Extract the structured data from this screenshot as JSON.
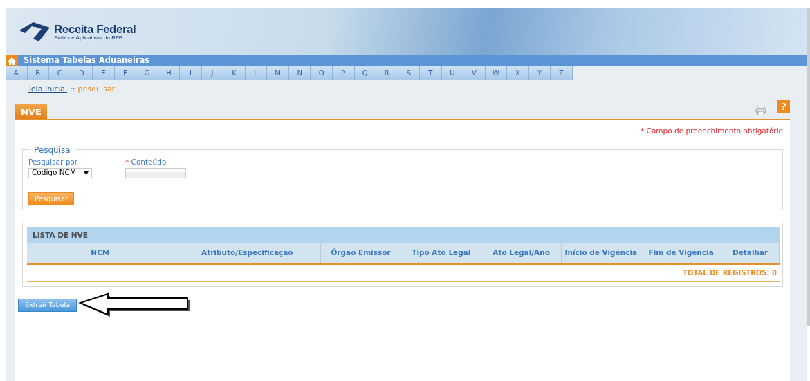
{
  "header": {
    "logo_title": "Receita Federal",
    "logo_subtitle": "Suíte de Aplicativos da RFB"
  },
  "system_title": "Sistema Tabelas Aduaneiras",
  "letters": [
    "A",
    "B",
    "C",
    "D",
    "E",
    "F",
    "G",
    "H",
    "I",
    "J",
    "K",
    "L",
    "M",
    "N",
    "O",
    "P",
    "Q",
    "R",
    "S",
    "T",
    "U",
    "V",
    "W",
    "X",
    "Y",
    "Z"
  ],
  "breadcrumb": {
    "home": "Tela Inicial",
    "separator": "::",
    "current": "pesquisar"
  },
  "tab": {
    "label": "NVE"
  },
  "help_icon_text": "?",
  "required_note": {
    "mark": "*",
    "text": "Campo de preenchimento obrigatório"
  },
  "search": {
    "legend": "Pesquisa",
    "search_by": {
      "label": "Pesquisar por",
      "value": "Código NCM"
    },
    "content": {
      "mark": "*",
      "label": "Conteúdo"
    },
    "button": "Pesquisar"
  },
  "table": {
    "title": "LISTA DE NVE",
    "columns": [
      "NCM",
      "Atributo/Especificação",
      "Órgão Emissor",
      "Tipo Ato Legal",
      "Ato Legal/Ano",
      "Início de Vigência",
      "Fim de Vigência",
      "Detalhar"
    ],
    "total": "TOTAL DE REGISTROS: 0"
  },
  "extract_button": "Extrair Tabela"
}
